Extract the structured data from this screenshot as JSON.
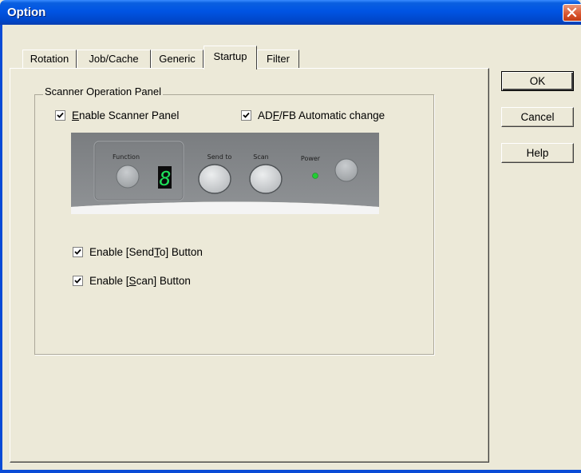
{
  "window": {
    "title": "Option"
  },
  "tabs": [
    {
      "label": "Rotation"
    },
    {
      "label": "Job/Cache"
    },
    {
      "label": "Generic"
    },
    {
      "label": "Startup",
      "active": true
    },
    {
      "label": "Filter"
    }
  ],
  "group": {
    "label": "Scanner Operation Panel"
  },
  "checkboxes": {
    "enable_panel": {
      "label_pre": "",
      "mnemonic": "E",
      "label_post": "nable Scanner Panel",
      "checked": true
    },
    "adf_fb": {
      "label_pre": "AD",
      "mnemonic": "F",
      "label_post": "/FB Automatic change",
      "checked": true
    },
    "send_to": {
      "label_pre": "Enable [Send",
      "mnemonic": "T",
      "label_post": "o] Button",
      "checked": true
    },
    "scan": {
      "label_pre": "Enable [",
      "mnemonic": "S",
      "label_post": "can] Button",
      "checked": true
    }
  },
  "panel": {
    "function_label": "Function",
    "digit": "8",
    "send_to_label": "Send to",
    "scan_label": "Scan",
    "power_label": "Power",
    "digit_color": "#1ee05a",
    "power_led_color": "#22cc33"
  },
  "buttons": {
    "ok": "OK",
    "cancel": "Cancel",
    "help": "Help"
  },
  "colors": {
    "face": "#ece9d8",
    "title_bar": "#0054e3",
    "close_button": "#d9532c"
  }
}
